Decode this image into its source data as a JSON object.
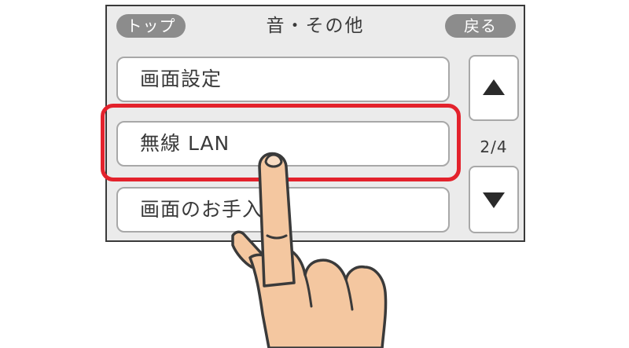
{
  "header": {
    "top_button_label": "トップ",
    "title": "音・その他",
    "back_button_label": "戻る"
  },
  "menu": {
    "items": [
      {
        "label": "画面設定",
        "highlighted": false
      },
      {
        "label": "無線 LAN",
        "highlighted": true
      },
      {
        "label": "画面のお手入れ",
        "highlighted": false
      }
    ]
  },
  "pagination": {
    "current": 2,
    "total": 4,
    "label": "2/4",
    "up_icon": "triangle-up-icon",
    "down_icon": "triangle-down-icon"
  },
  "colors": {
    "highlight": "#e3222c",
    "pill_button": "#8c8c8c",
    "screen_background": "#ebebeb",
    "hand_skin": "#f4c7a0",
    "outline": "#3a3a3a"
  },
  "overlay": {
    "pointer": "finger-tap-icon",
    "highlighted_item": "無線 LAN"
  }
}
